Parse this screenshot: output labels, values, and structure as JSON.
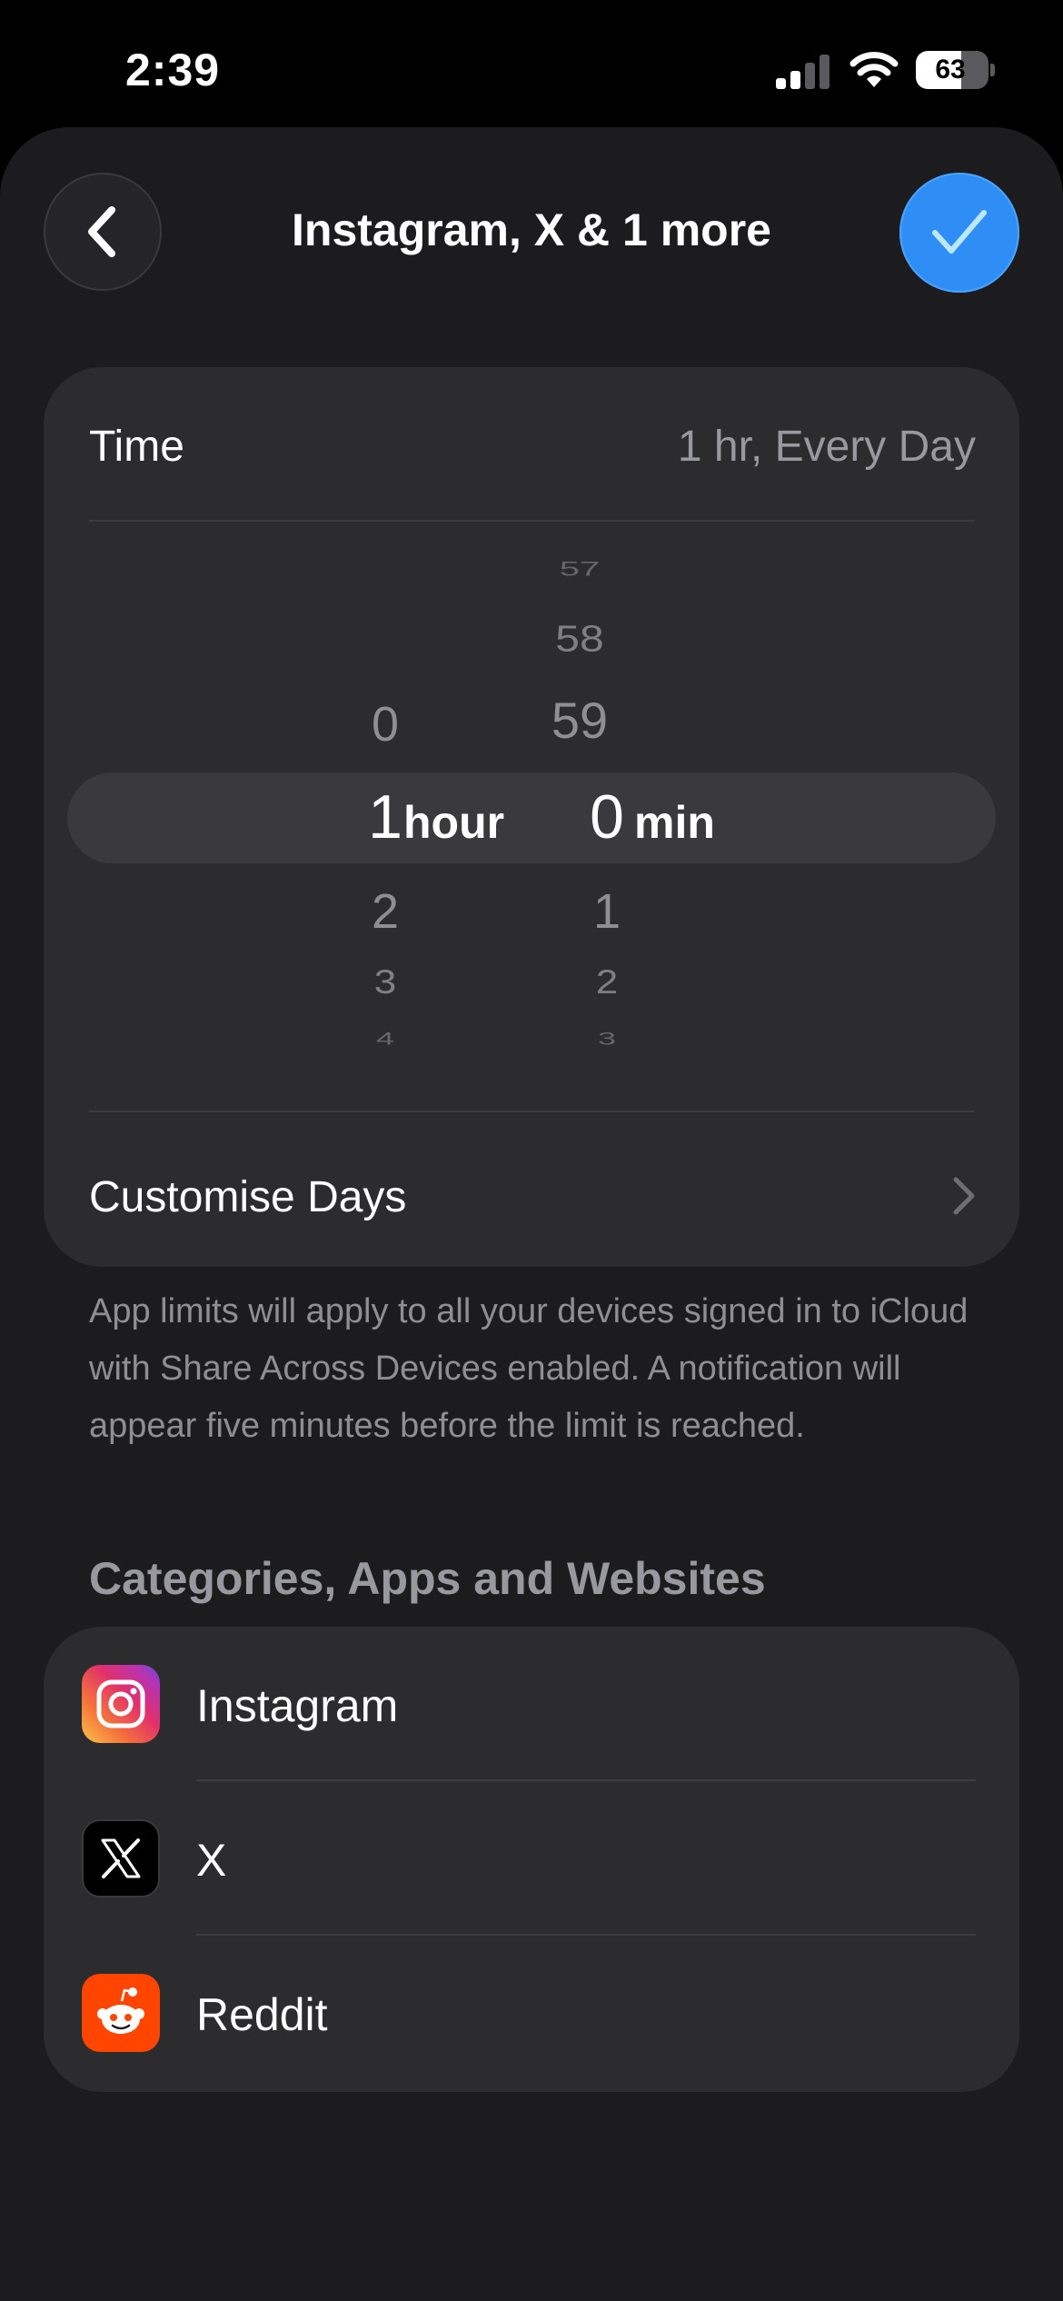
{
  "status_bar": {
    "time": "2:39",
    "battery": 63
  },
  "nav": {
    "title": "Instagram, X & 1 more",
    "back_icon": "chevron-left-icon",
    "done_icon": "checkmark-icon",
    "accent_color": "#2f8ef5"
  },
  "time_card": {
    "label": "Time",
    "value": "1 hr, Every Day",
    "picker": {
      "hours_above": [
        "0"
      ],
      "hours_selected": "1",
      "hours_unit": "hour",
      "hours_below": [
        "2",
        "3",
        "4"
      ],
      "minutes_above": [
        "57",
        "58",
        "59"
      ],
      "minutes_selected": "0",
      "minutes_unit": "min",
      "minutes_below": [
        "1",
        "2",
        "3"
      ]
    },
    "customise_days_label": "Customise Days"
  },
  "footnote": "App limits will apply to all your devices signed in to iCloud with Share Across Devices enabled. A notification will appear five minutes before the limit is reached.",
  "section_title": "Categories, Apps and Websites",
  "apps": [
    {
      "name": "Instagram",
      "icon": "instagram-icon"
    },
    {
      "name": "X",
      "icon": "x-icon"
    },
    {
      "name": "Reddit",
      "icon": "reddit-icon"
    }
  ]
}
